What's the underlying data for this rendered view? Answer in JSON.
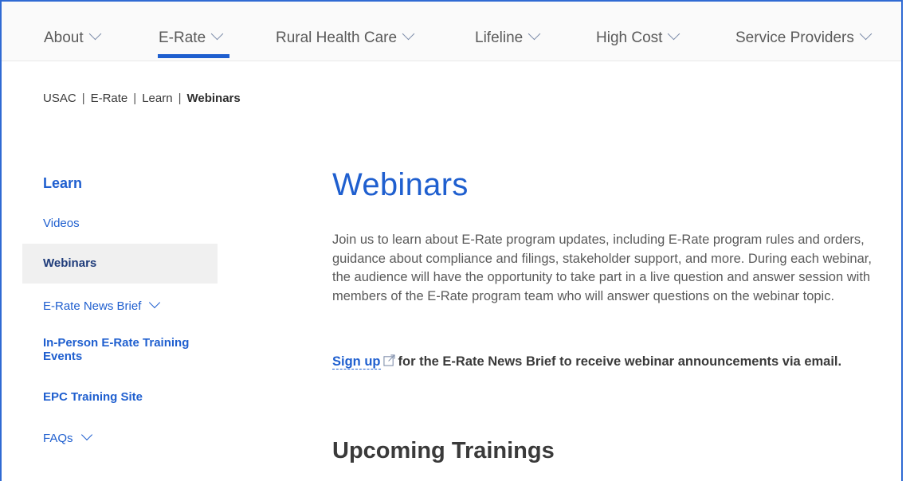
{
  "nav": {
    "items": [
      {
        "label": "About"
      },
      {
        "label": "E-Rate"
      },
      {
        "label": "Rural Health Care"
      },
      {
        "label": "Lifeline"
      },
      {
        "label": "High Cost"
      },
      {
        "label": "Service Providers"
      }
    ],
    "active_index": 1
  },
  "breadcrumb": {
    "items": [
      "USAC",
      "E-Rate",
      "Learn"
    ],
    "separator": "|",
    "current": "Webinars"
  },
  "sidebar": {
    "title": "Learn",
    "items": [
      {
        "label": "Videos"
      },
      {
        "label": "Webinars"
      },
      {
        "label": "E-Rate News Brief"
      },
      {
        "label": "In-Person E-Rate Training Events"
      },
      {
        "label": "EPC Training Site"
      },
      {
        "label": "FAQs"
      }
    ]
  },
  "main": {
    "title": "Webinars",
    "intro": "Join us to learn about E-Rate program updates, including E-Rate program rules and orders, guidance about compliance and filings, stakeholder support, and more. During each webinar, the audience will have the opportunity to take part in a live question and answer session with members of the E-Rate program team who will answer questions on the webinar topic.",
    "signup_link": "Sign up",
    "signup_text": "for the E-Rate News Brief to receive webinar announcements via email.",
    "section_title": "Upcoming Trainings"
  },
  "colors": {
    "accent": "#1f5fcf",
    "text": "#3a3a3a",
    "muted_text": "#5a5a5a",
    "active_bg": "#f0f0f0"
  }
}
